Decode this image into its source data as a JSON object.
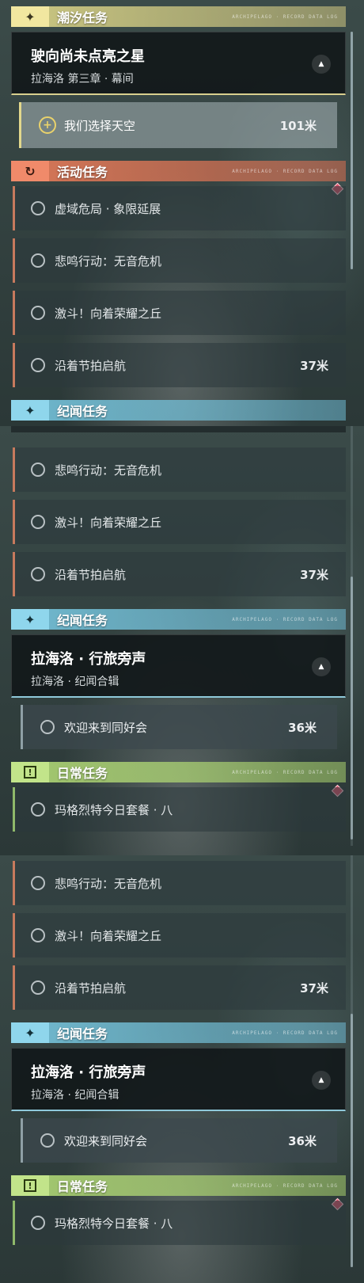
{
  "panel1": {
    "trail_header": {
      "title": "潮汐任务",
      "deco": "ARCHIPELAGO · RECORD DATA LOG"
    },
    "chapter": {
      "title": "驶向尚未点亮之星",
      "subtitle": "拉海洛 第三章 · 幕间",
      "collapse_glyph": "▲"
    },
    "active_quest": {
      "plus_glyph": "+",
      "label": "我们选择天空",
      "distance": "101米"
    },
    "event_header": {
      "title": "活动任务",
      "icon": "↻",
      "deco": "ARCHIPELAGO · RECORD DATA LOG"
    },
    "event_items": [
      {
        "label": "虚域危局 · 象限延展",
        "distance": ""
      },
      {
        "label": "悲鸣行动：无音危机",
        "distance": ""
      },
      {
        "label": "激斗！向着荣耀之丘",
        "distance": ""
      },
      {
        "label": "沿着节拍启航",
        "distance": "37米"
      }
    ],
    "story_header_partial": {
      "title": "纪闻任务"
    }
  },
  "panel2": {
    "event_items": [
      {
        "label": "悲鸣行动：无音危机",
        "distance": ""
      },
      {
        "label": "激斗！向着荣耀之丘",
        "distance": ""
      },
      {
        "label": "沿着节拍启航",
        "distance": "37米"
      }
    ],
    "story_header": {
      "title": "纪闻任务",
      "deco": "ARCHIPELAGO · RECORD DATA LOG"
    },
    "story_chapter": {
      "title": "拉海洛 · 行旅旁声",
      "subtitle": "拉海洛 · 纪闻合辑",
      "collapse_glyph": "▲"
    },
    "story_sub": {
      "label": "欢迎来到同好会",
      "distance": "36米"
    },
    "daily_header": {
      "title": "日常任务",
      "icon": "!",
      "deco": "ARCHIPELAGO · RECORD DATA LOG"
    },
    "daily_item": {
      "label": "玛格烈特今日套餐 · 八",
      "distance": ""
    }
  },
  "panel3": {
    "event_items": [
      {
        "label": "悲鸣行动：无音危机",
        "distance": ""
      },
      {
        "label": "激斗！向着荣耀之丘",
        "distance": ""
      },
      {
        "label": "沿着节拍启航",
        "distance": "37米"
      }
    ],
    "story_header": {
      "title": "纪闻任务",
      "deco": "ARCHIPELAGO · RECORD DATA LOG"
    },
    "story_chapter": {
      "title": "拉海洛 · 行旅旁声",
      "subtitle": "拉海洛 · 纪闻合辑",
      "collapse_glyph": "▲"
    },
    "story_sub": {
      "label": "欢迎来到同好会",
      "distance": "36米"
    },
    "daily_header": {
      "title": "日常任务",
      "icon": "!",
      "deco": "ARCHIPELAGO · RECORD DATA LOG"
    },
    "daily_item": {
      "label": "玛格烈特今日套餐 · 八",
      "distance": ""
    }
  },
  "icons": {
    "trail": "star-icon",
    "event": "refresh-icon",
    "story": "star-icon",
    "daily": "alert-box-icon",
    "marker": "diamond-marker-icon"
  },
  "colors": {
    "trail": "#e6de8c",
    "event": "#eb7d5a",
    "story": "#78c8e1",
    "daily": "#b4dc78",
    "marker": "#d9536a"
  }
}
